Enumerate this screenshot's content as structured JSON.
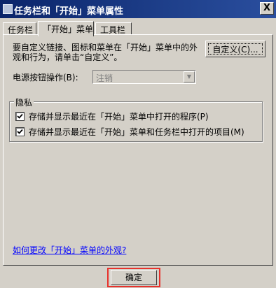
{
  "window": {
    "title": "任务栏和「开始」菜单属性",
    "close_label": "X"
  },
  "tabs": [
    "任务栏",
    "「开始」菜单",
    "工具栏"
  ],
  "active_tab": 1,
  "start_menu": {
    "description": "要自定义链接、图标和菜单在「开始」菜单中的外观和行为，请单击“自定义”。",
    "customize_button": "自定义(C)...",
    "power_label": "电源按钮操作(B):",
    "power_value": "注销",
    "privacy": {
      "title": "隐私",
      "options": [
        {
          "label": "存储并显示最近在「开始」菜单中打开的程序(P)",
          "checked": true
        },
        {
          "label": "存储并显示最近在「开始」菜单和任务栏中打开的项目(M)",
          "checked": true
        }
      ]
    },
    "help_link": "如何更改「开始」菜单的外观?"
  },
  "footer": {
    "ok_button": "确定"
  },
  "colors": {
    "highlight": "#e8322c",
    "link": "#0000ff",
    "titlebar": "#0a246a"
  }
}
